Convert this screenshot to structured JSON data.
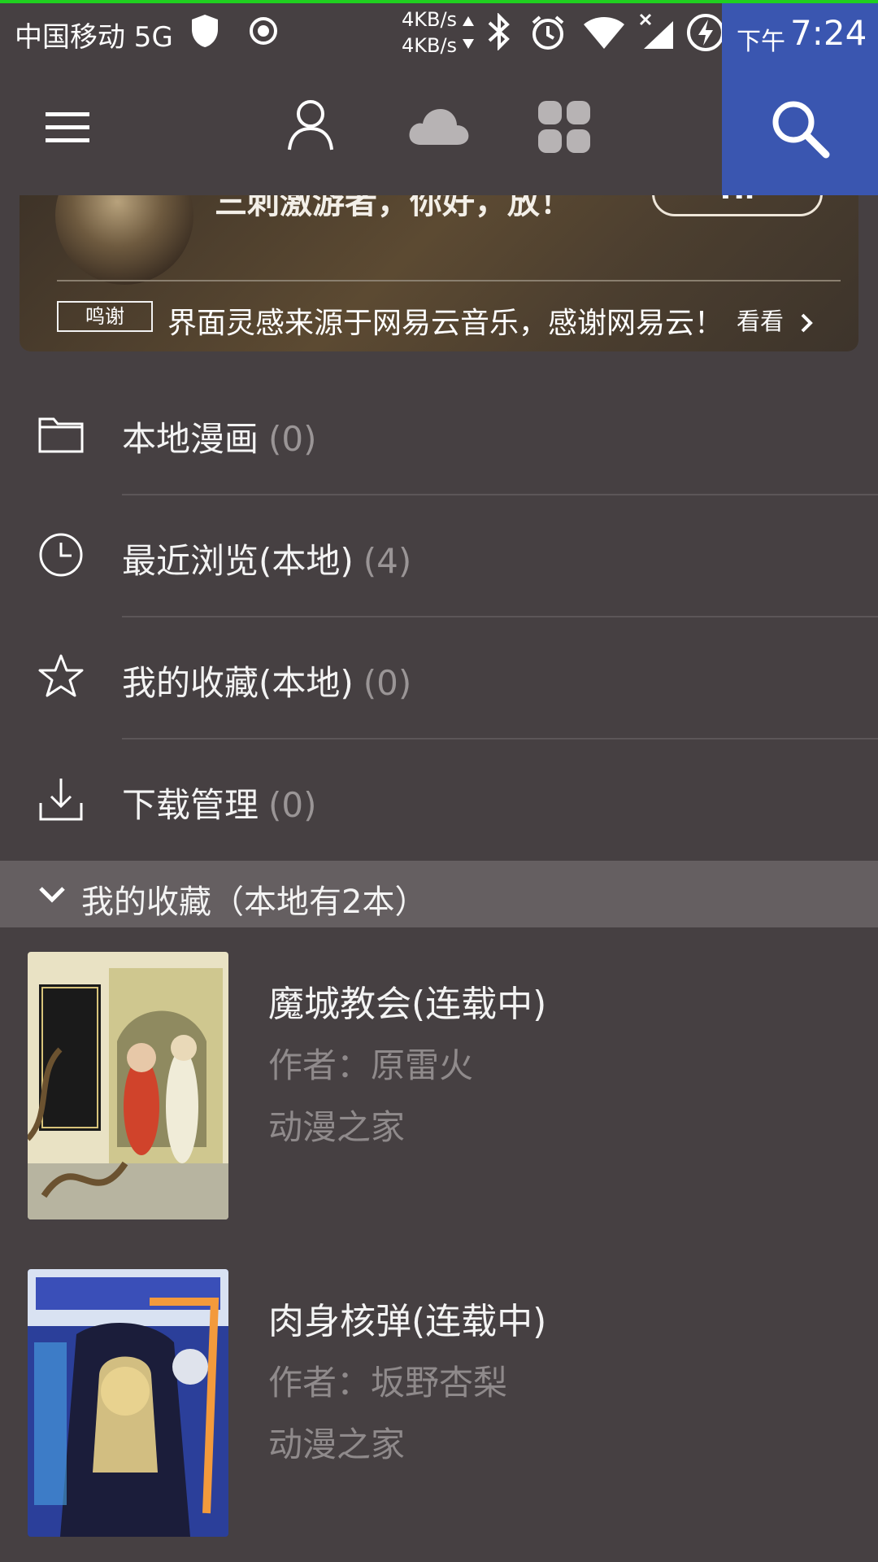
{
  "status_bar": {
    "carrier": "中国移动 5G",
    "net_speed_up": "4KB/s",
    "net_speed_down": "4KB/s",
    "ampm": "下午",
    "time": "7:24",
    "accent_color": "#3a56b0"
  },
  "toolbar": {
    "menu_icon": "menu-icon",
    "profile_icon": "profile-icon",
    "cloud_icon": "cloud-icon",
    "apps_icon": "apps-icon",
    "search_icon": "search-icon"
  },
  "banner": {
    "headline": "三刺激游者，你好，放！",
    "button_label": "Hi",
    "tag": "鸣谢",
    "message": "界面灵感来源于网易云音乐，感谢网易云！",
    "more": "看看"
  },
  "menu": [
    {
      "label": "本地漫画",
      "count": "(0)",
      "icon": "folder-icon"
    },
    {
      "label": "最近浏览(本地)",
      "count": "(4)",
      "icon": "clock-icon"
    },
    {
      "label": "我的收藏(本地)",
      "count": "(0)",
      "icon": "star-icon"
    },
    {
      "label": "下载管理",
      "count": "(0)",
      "icon": "download-icon"
    }
  ],
  "section": {
    "title": "我的收藏（本地有2本）"
  },
  "books": [
    {
      "title": "魔城教会(连载中)",
      "author": "作者：原雷火",
      "source": "动漫之家"
    },
    {
      "title": "肉身核弹(连载中)",
      "author": "作者：坂野杏梨",
      "source": "动漫之家"
    }
  ]
}
